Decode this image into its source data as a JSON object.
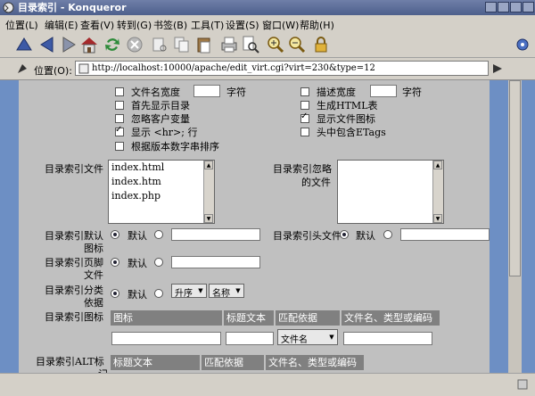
{
  "window": {
    "title": "目录索引 - Konqueror"
  },
  "menu": [
    "位置(L)",
    "编辑(E)",
    "查看(V)",
    "转到(G)",
    "书签(B)",
    "工具(T)",
    "设置(S)",
    "窗口(W)",
    "帮助(H)"
  ],
  "location": {
    "label": "位置(O):",
    "url": "http://localhost:10000/apache/edit_virt.cgi?virt=230&type=12"
  },
  "options": {
    "filename_width": "文件名宽度",
    "chars": "字符",
    "desc_width": "描述宽度",
    "chars2": "字符",
    "dirs_first": "首先显示目录",
    "gen_html": "生成HTML表",
    "ignore_client": "忽略客户变量",
    "show_icons": "显示文件图标",
    "show_hr": "显示 <hr>; 行",
    "head_etags": "头中包含ETags",
    "version_sort": "根据版本数字串排序"
  },
  "index_files": {
    "label": "目录索引文件",
    "lines": [
      "index.html",
      "index.htm",
      "index.php"
    ]
  },
  "ignore_files": {
    "label_line1": "目录索引忽略",
    "label_line2": "的文件"
  },
  "default_icon": {
    "label_line1": "目录索引默认",
    "label_line2": "图标",
    "radio_label": "默认"
  },
  "header_file": {
    "label": "目录索引头文件",
    "radio_label": "默认"
  },
  "footer_file": {
    "label_line1": "目录索引页脚",
    "label_line2": "文件",
    "radio_label": "默认"
  },
  "sort_by": {
    "label_line1": "目录索引分类",
    "label_line2": "依据",
    "radio_label": "默认",
    "order_value": "升序",
    "field_value": "名称"
  },
  "icons_table": {
    "label": "目录索引图标",
    "headers": [
      "图标",
      "标题文本",
      "匹配依据",
      "文件名、类型或编码"
    ],
    "match_value": "文件名"
  },
  "alt_table": {
    "label_line1": "目录索引ALT标",
    "label_line2": "记",
    "headers": [
      "标题文本",
      "匹配依据",
      "文件名、类型或编码"
    ]
  }
}
